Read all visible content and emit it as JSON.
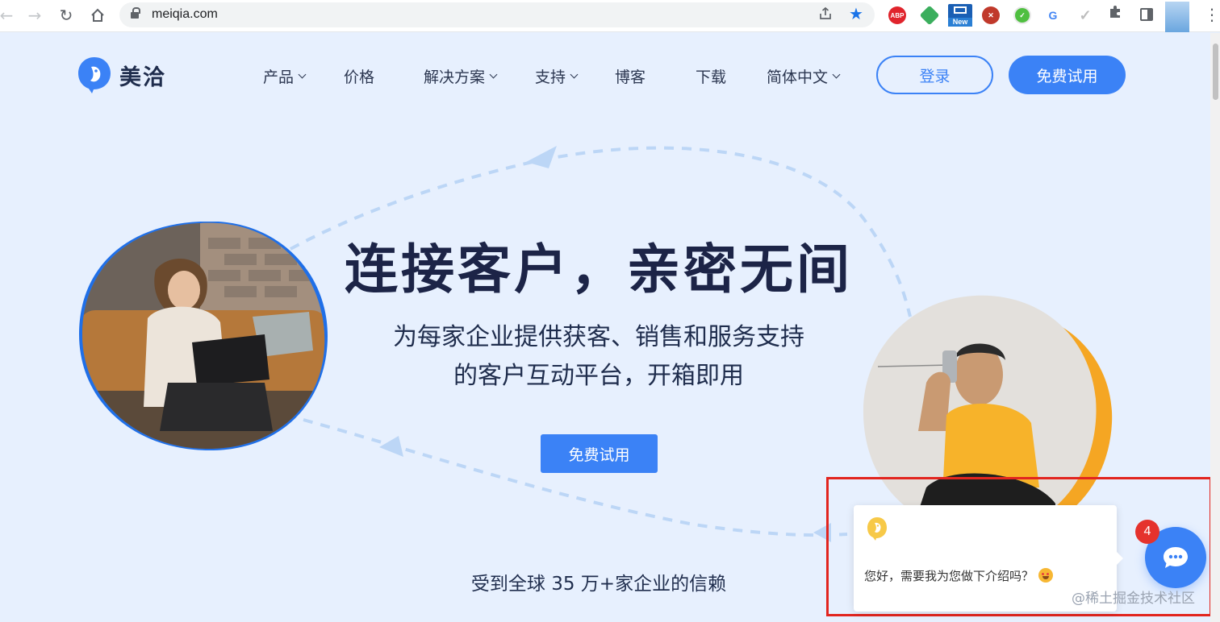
{
  "browser": {
    "url": "meiqia.com",
    "extension_new_label": "New",
    "extension_abp_label": "ABP",
    "icons": [
      "back-icon",
      "forward-icon",
      "reload-icon",
      "home-icon",
      "lock-icon",
      "share-icon",
      "star-icon",
      "puzzle-icon",
      "side-panel-icon",
      "menu-icon"
    ]
  },
  "brand": {
    "name": "美洽",
    "primary_color": "#3b82f6",
    "dark_text_color": "#1c2447",
    "accent_orange": "#f5a623"
  },
  "nav": {
    "items": [
      {
        "label": "产品",
        "has_dropdown": true
      },
      {
        "label": "价格",
        "has_dropdown": false
      },
      {
        "label": "解决方案",
        "has_dropdown": true
      },
      {
        "label": "支持",
        "has_dropdown": true
      },
      {
        "label": "博客",
        "has_dropdown": false
      },
      {
        "label": "下载",
        "has_dropdown": false
      },
      {
        "label": "简体中文",
        "has_dropdown": true
      }
    ],
    "login_label": "登录",
    "trial_label": "免费试用"
  },
  "hero": {
    "title": "连接客户，亲密无间",
    "subtitle_line1": "为每家企业提供获客、销售和服务支持",
    "subtitle_line2": "的客户互动平台，开箱即用",
    "cta_label": "免费试用",
    "trust_text": "受到全球 35 万+家企业的信赖"
  },
  "chat_widget": {
    "greeting": "您好，需要我为您做下介绍吗？",
    "unread_count": "4",
    "highlight_color": "#e2251f"
  },
  "watermark": "@稀土掘金技术社区"
}
